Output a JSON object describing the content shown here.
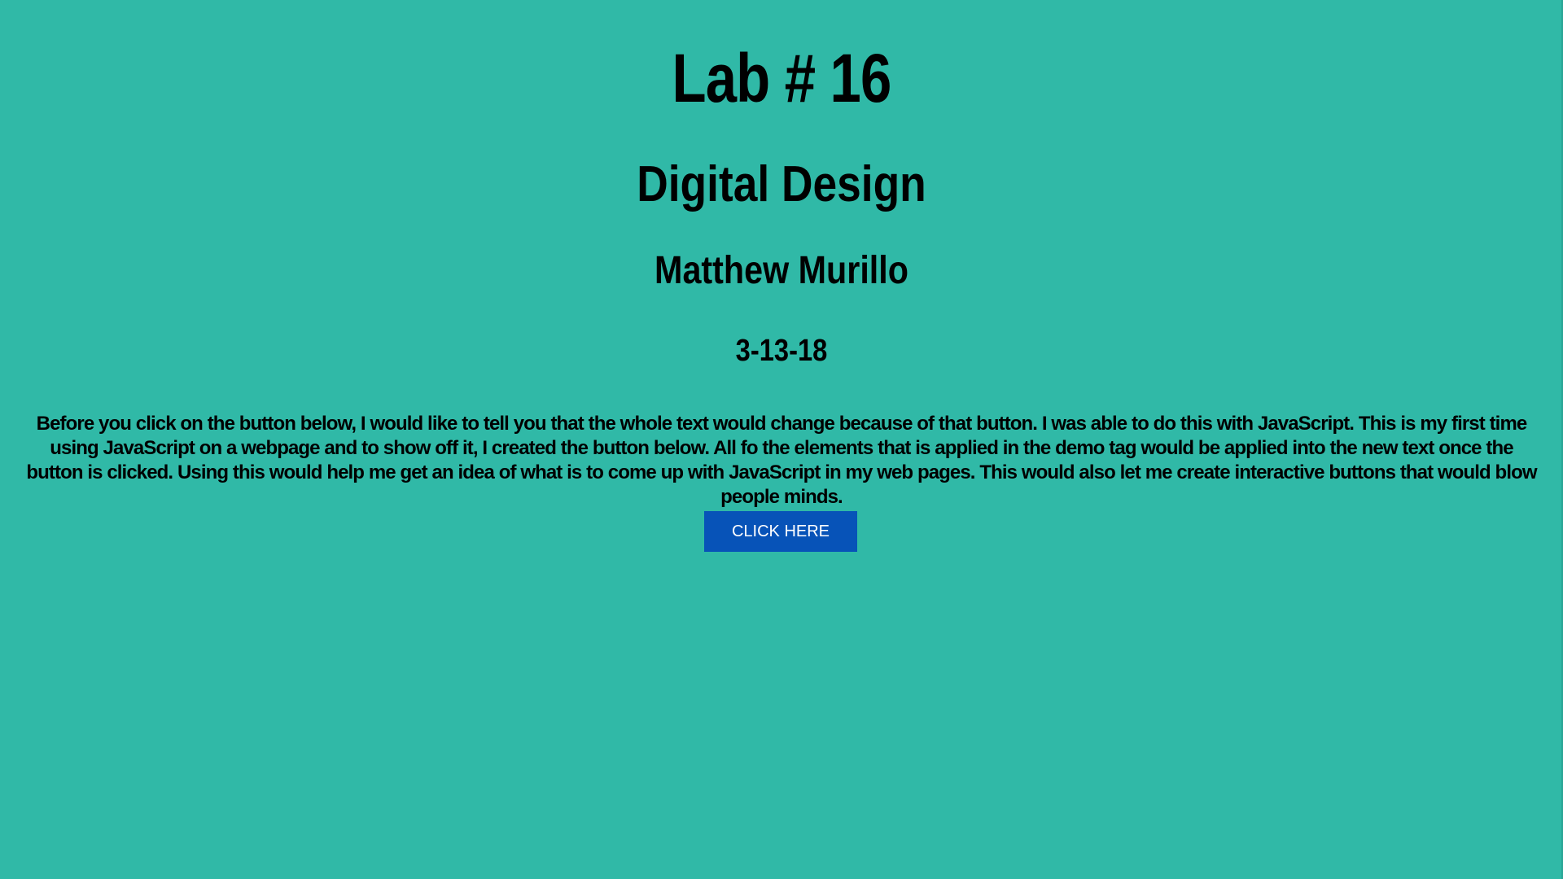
{
  "page": {
    "background_color": "#30b9a7",
    "title": "Lab # 16",
    "subtitle": "Digital Design",
    "author": "Matthew Murillo",
    "date": "3-13-18",
    "demo_text": "Before you click on the button below, I would like to tell you that the whole text would change because of that button. I was able to do this with JavaScript. This is my first time using JavaScript on a webpage and to show off it, I created the button below. All fo the elements that is applied in the demo tag would be applied into the new text once the button is clicked. Using this would help me get an idea of what is to come up with JavaScript in my web pages. This would also let me create interactive buttons that would blow people minds."
  },
  "button": {
    "label": "CLICK HERE",
    "color": "#0753b8",
    "text_color": "#ffffff"
  }
}
